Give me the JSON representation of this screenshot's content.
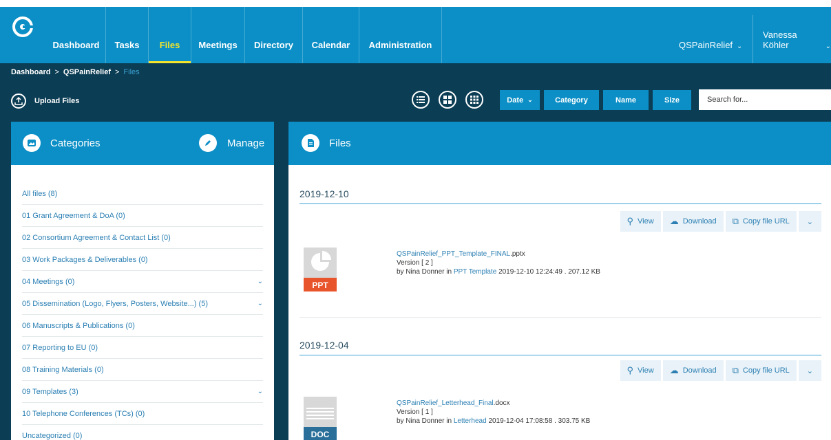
{
  "nav": {
    "items": [
      {
        "label": "Dashboard",
        "active": false
      },
      {
        "label": "Tasks",
        "active": false
      },
      {
        "label": "Files",
        "active": true
      },
      {
        "label": "Meetings",
        "active": false
      },
      {
        "label": "Directory",
        "active": false
      },
      {
        "label": "Calendar",
        "active": false
      },
      {
        "label": "Administration",
        "active": false
      }
    ],
    "project": "QSPainRelief",
    "user": "Vanessa Köhler"
  },
  "breadcrumb": [
    "Dashboard",
    "QSPainRelief",
    "Files"
  ],
  "toolbar": {
    "upload_label": "Upload Files",
    "sort": {
      "date": "Date",
      "category": "Category",
      "name": "Name",
      "size": "Size"
    },
    "search_placeholder": "Search for..."
  },
  "categories": {
    "title": "Categories",
    "manage_label": "Manage",
    "items": [
      {
        "label": "All files (8)",
        "expandable": false
      },
      {
        "label": "01 Grant Agreement & DoA (0)",
        "expandable": false
      },
      {
        "label": "02 Consortium Agreement & Contact List (0)",
        "expandable": false
      },
      {
        "label": "03 Work Packages & Deliverables (0)",
        "expandable": false
      },
      {
        "label": "04 Meetings (0)",
        "expandable": true
      },
      {
        "label": "05 Dissemination (Logo, Flyers, Posters, Website...) (5)",
        "expandable": true
      },
      {
        "label": "06 Manuscripts & Publications (0)",
        "expandable": false
      },
      {
        "label": "07 Reporting to EU (0)",
        "expandable": false
      },
      {
        "label": "08 Training Materials (0)",
        "expandable": false
      },
      {
        "label": "09 Templates (3)",
        "expandable": true
      },
      {
        "label": "10 Telephone Conferences (TCs) (0)",
        "expandable": false
      },
      {
        "label": "Uncategorized (0)",
        "expandable": false
      }
    ]
  },
  "files": {
    "title": "Files",
    "actions": {
      "view": "View",
      "download": "Download",
      "copy": "Copy file URL"
    },
    "groups": [
      {
        "date": "2019-12-10",
        "file": {
          "name_base": "QSPainRelief_PPT_Template_FINAL",
          "ext": ".pptx",
          "type": "PPT",
          "version": "Version [ 2 ]",
          "by": "by Nina Donner in",
          "category": "PPT Template",
          "details": "2019-12-10 12:24:49 . 207.12 KB"
        }
      },
      {
        "date": "2019-12-04",
        "file": {
          "name_base": "QSPainRelief_Letterhead_Final",
          "ext": ".docx",
          "type": "DOC",
          "version": "Version [ 1 ]",
          "by": "by Nina Donner in",
          "category": "Letterhead",
          "details": "2019-12-04 17:08:58 . 303.75 KB"
        }
      }
    ]
  },
  "colors": {
    "nav": "#0b8fc6",
    "background": "#0b3d54",
    "active": "#f5e52b",
    "ppt": "#e8542b",
    "doc": "#2a6f9a"
  }
}
